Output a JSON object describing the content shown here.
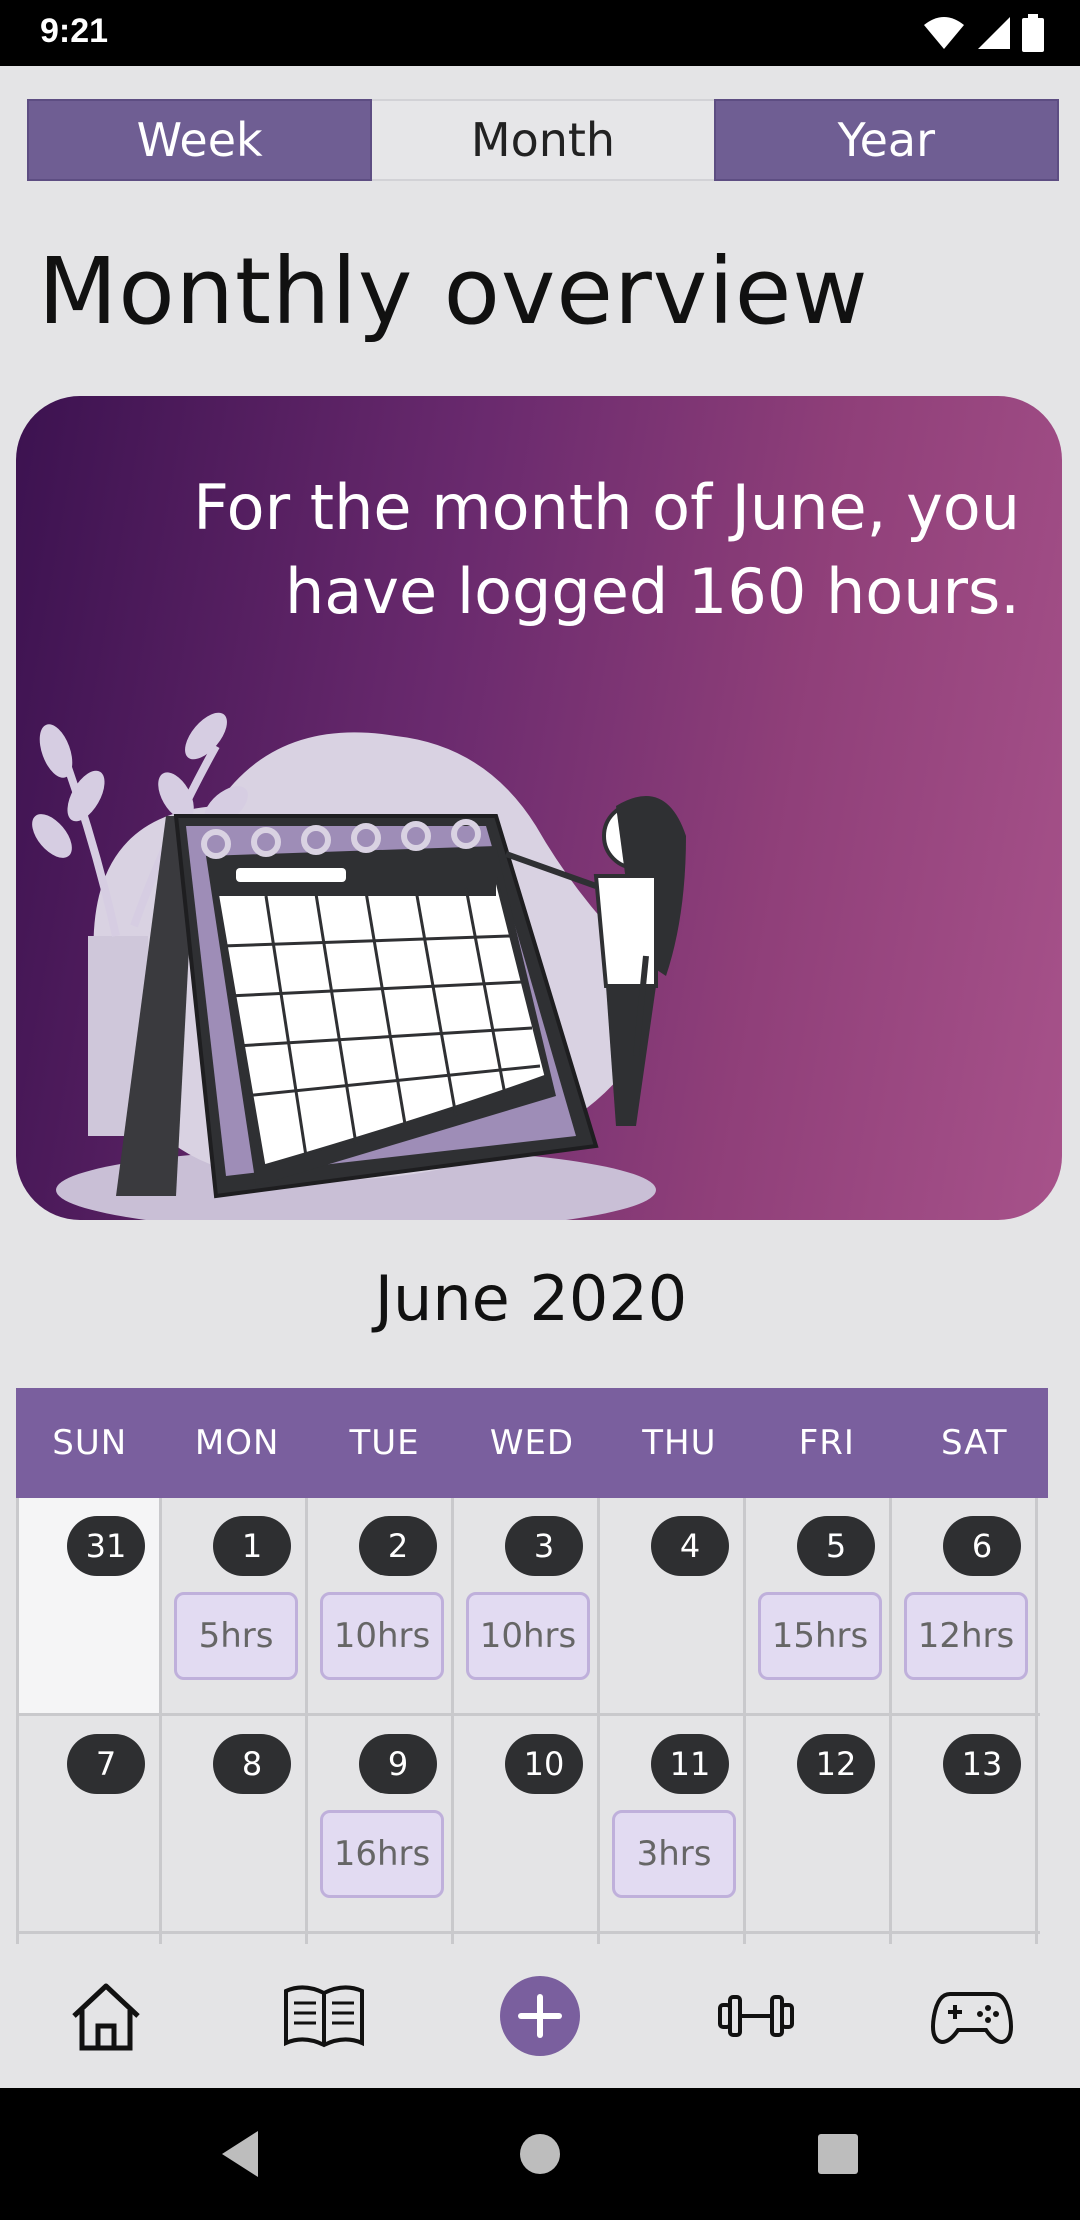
{
  "status_bar": {
    "time": "9:21",
    "icons": [
      "wifi-icon",
      "signal-icon",
      "battery-icon"
    ]
  },
  "tabs": [
    {
      "label": "Week",
      "active": false
    },
    {
      "label": "Month",
      "active": true
    },
    {
      "label": "Year",
      "active": false
    }
  ],
  "page_title": "Monthly overview",
  "hero": {
    "message": "For the month of June, you have logged 160 hours."
  },
  "calendar": {
    "month_label": "June 2020",
    "weekdays": [
      "SUN",
      "MON",
      "TUE",
      "WED",
      "THU",
      "FRI",
      "SAT"
    ],
    "rows": [
      [
        {
          "day": "31",
          "hours": "",
          "outside_month": true
        },
        {
          "day": "1",
          "hours": "5hrs"
        },
        {
          "day": "2",
          "hours": "10hrs"
        },
        {
          "day": "3",
          "hours": "10hrs"
        },
        {
          "day": "4",
          "hours": ""
        },
        {
          "day": "5",
          "hours": "15hrs"
        },
        {
          "day": "6",
          "hours": "12hrs"
        }
      ],
      [
        {
          "day": "7",
          "hours": ""
        },
        {
          "day": "8",
          "hours": ""
        },
        {
          "day": "9",
          "hours": "16hrs"
        },
        {
          "day": "10",
          "hours": ""
        },
        {
          "day": "11",
          "hours": "3hrs"
        },
        {
          "day": "12",
          "hours": ""
        },
        {
          "day": "13",
          "hours": ""
        }
      ],
      [
        {
          "day": "",
          "hours": ""
        },
        {
          "day": "",
          "hours": ""
        },
        {
          "day": "",
          "hours": ""
        },
        {
          "day": "",
          "hours": ""
        },
        {
          "day": "",
          "hours": ""
        },
        {
          "day": "",
          "hours": ""
        },
        {
          "day": "",
          "hours": ""
        }
      ]
    ]
  },
  "bottom_nav": {
    "items": [
      "home-icon",
      "book-icon",
      "add-icon",
      "dumbbell-icon",
      "gamepad-icon"
    ],
    "accent": "#7a5f9e"
  },
  "system_nav": [
    "back-icon",
    "home-circle-icon",
    "recents-icon"
  ],
  "colors": {
    "tab_purple": "#6f5e93",
    "calendar_header": "#7a5f9e",
    "hero_gradient_start": "#3c1250",
    "hero_gradient_end": "#a7528a",
    "hours_pill": "#e2dbf2",
    "day_badge": "#2e2f31"
  }
}
